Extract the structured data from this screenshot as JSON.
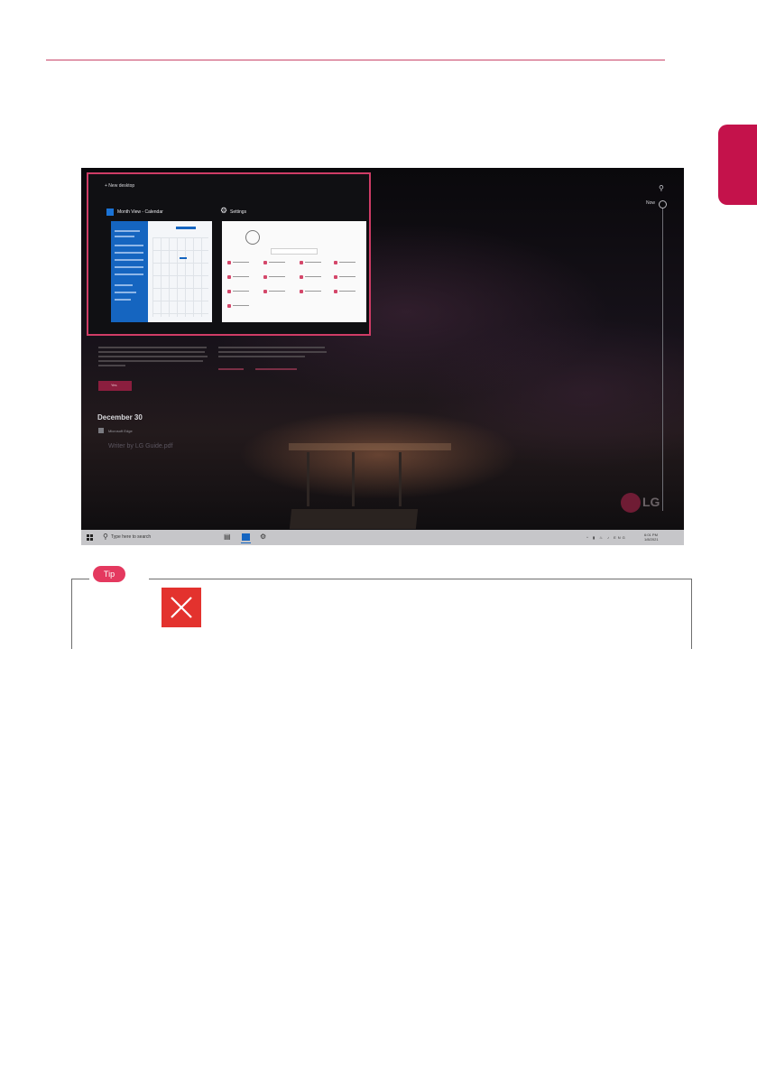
{
  "screenshot": {
    "task_view": {
      "new_desktop_label": "+ New desktop",
      "windows": [
        {
          "title": "Month View - Calendar",
          "icon": "calendar-icon"
        },
        {
          "title": "Settings",
          "icon": "gear-icon"
        }
      ]
    },
    "timeline": {
      "now_label": "Now",
      "search_icon": "search-icon"
    },
    "background": {
      "button_label": "Yes",
      "date_heading": "December 30",
      "subheading": "Microsoft Edge",
      "file_label": "Writer by LG Guide.pdf",
      "logo_text": "LG"
    },
    "taskbar": {
      "search_placeholder": "Type here to search",
      "clock_time": "6:01 PM",
      "clock_date": "1/8/2021",
      "language": "ENG"
    }
  },
  "tip": {
    "badge_label": "Tip",
    "icon": "close-icon",
    "colors": {
      "badge": "#e4395f",
      "icon_bg": "#e3322e",
      "accent": "#c4124b"
    }
  }
}
